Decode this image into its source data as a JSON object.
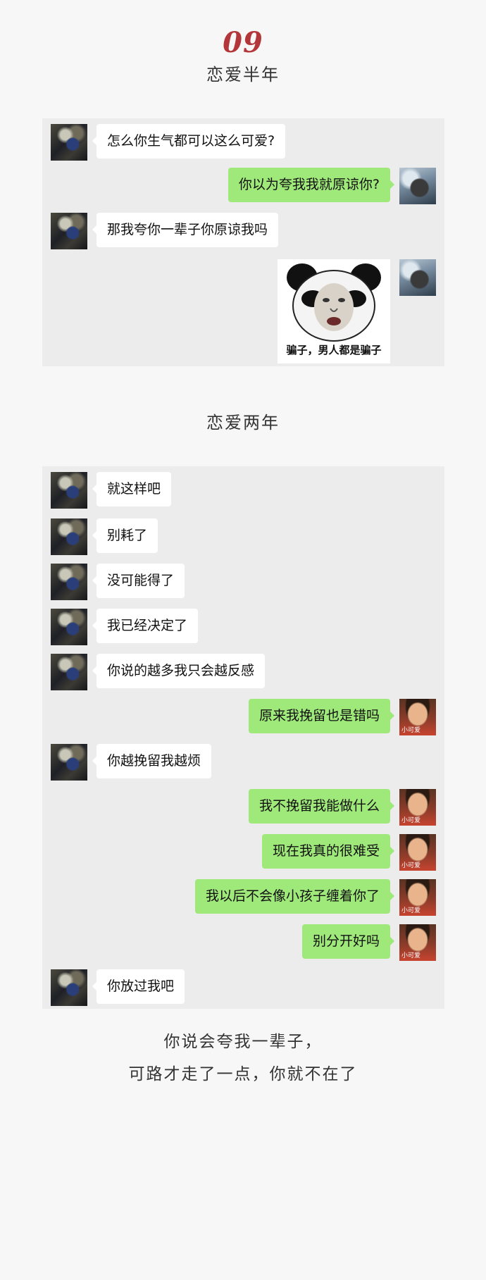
{
  "header": {
    "number": "09",
    "section1_title": "恋爱半年",
    "section2_title": "恋爱两年"
  },
  "chat1": {
    "messages": [
      {
        "side": "left",
        "text": "怎么你生气都可以这么可爱?"
      },
      {
        "side": "right",
        "text": "你以为夸我我就原谅你?"
      },
      {
        "side": "left",
        "text": "那我夸你一辈子你原谅我吗"
      },
      {
        "side": "right",
        "sticker": "panda-meme",
        "caption": "骗子，男人都是骗子"
      }
    ]
  },
  "chat2": {
    "messages": [
      {
        "side": "left",
        "text": "就这样吧"
      },
      {
        "side": "left",
        "text": "别耗了"
      },
      {
        "side": "left",
        "text": "没可能得了"
      },
      {
        "side": "left",
        "text": "我已经决定了"
      },
      {
        "side": "left",
        "text": "你说的越多我只会越反感"
      },
      {
        "side": "right",
        "text": "原来我挽留也是错吗"
      },
      {
        "side": "left",
        "text": "你越挽留我越烦"
      },
      {
        "side": "right",
        "text": "我不挽留我能做什么"
      },
      {
        "side": "right",
        "text": "现在我真的很难受"
      },
      {
        "side": "right",
        "text": "我以后不会像小孩子缠着你了"
      },
      {
        "side": "right",
        "text": "别分开好吗"
      },
      {
        "side": "left",
        "text": "你放过我吧"
      }
    ],
    "avatar_tag": "小可爱"
  },
  "footer": {
    "line1": "你说会夸我一辈子，",
    "line2": "可路才走了一点，你就不在了"
  },
  "colors": {
    "accent_red": "#b3373a",
    "bubble_green": "#9fe87a",
    "chat_bg": "#ececec"
  }
}
